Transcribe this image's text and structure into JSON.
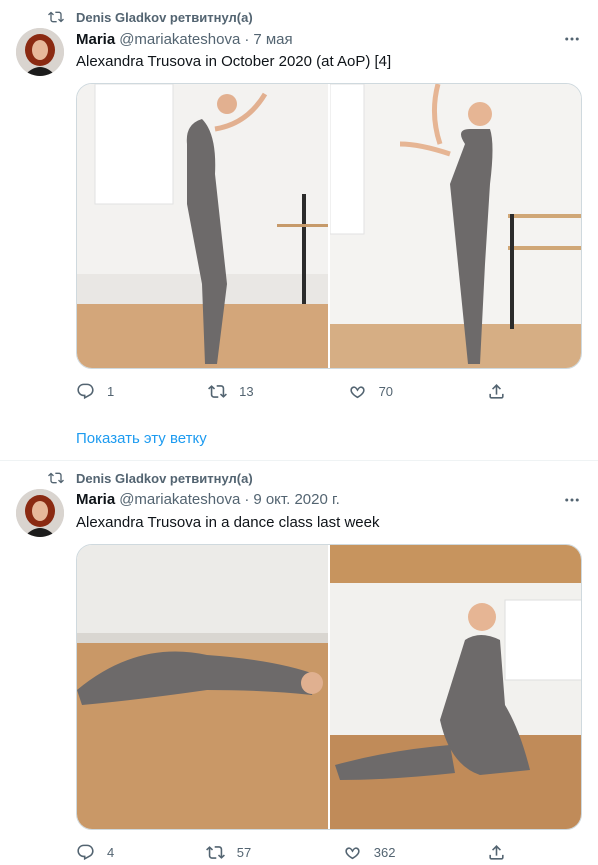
{
  "tweets": [
    {
      "retweeted_by": "Denis Gladkov ретвитнул(а)",
      "name": "Maria",
      "handle": "@mariakateshova",
      "sep": "·",
      "date": "7 мая",
      "text": "Alexandra Trusova in October 2020 (at AoP) [4]",
      "replies": "1",
      "retweets": "13",
      "likes": "70"
    },
    {
      "retweeted_by": "Denis Gladkov ретвитнул(а)",
      "name": "Maria",
      "handle": "@mariakateshova",
      "sep": "·",
      "date": "9 окт. 2020 г.",
      "text": "Alexandra Trusova in a dance class last week",
      "replies": "4",
      "retweets": "57",
      "likes": "362"
    }
  ],
  "show_thread": "Показать эту ветку",
  "colors": {
    "accent": "#1d9bf0",
    "secondary_text": "#536471",
    "border": "#cfd9de"
  }
}
